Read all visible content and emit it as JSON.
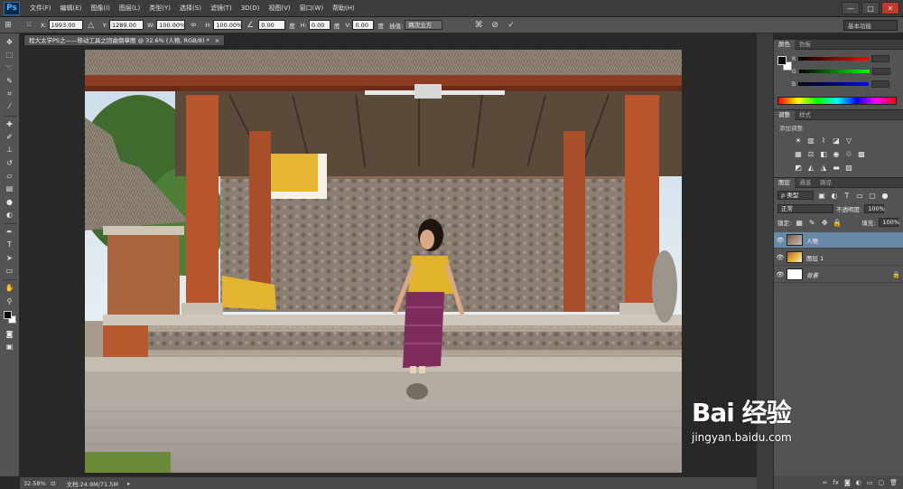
{
  "app": {
    "logo": "Ps"
  },
  "menu": [
    "文件(F)",
    "编辑(E)",
    "图像(I)",
    "图层(L)",
    "类型(Y)",
    "选择(S)",
    "滤镜(T)",
    "3D(D)",
    "视图(V)",
    "窗口(W)",
    "帮助(H)"
  ],
  "window_controls": {
    "minimize": "—",
    "restore": "□",
    "close": "✕"
  },
  "options": {
    "x_label": "X:",
    "x_value": "1993.00 像",
    "y_label": "Y:",
    "y_value": "1289.00 像",
    "w_label": "W:",
    "w_value": "100.00%",
    "h_label": "H:",
    "h_value": "100.00%",
    "angle_value": "0.00",
    "angle_unit": "度",
    "hskew_label": "H:",
    "hskew_value": "0.00",
    "hskew_unit": "度",
    "vskew_label": "V:",
    "vskew_value": "0.00",
    "vskew_unit": "度",
    "interp_label": "插值:",
    "interp_value": "两次立方",
    "workspace": "基本功能"
  },
  "document": {
    "tab_title": "程大太学PS之——移动工具之回曲倒章图 @ 32.6% (人物, RGB/8) *",
    "close": "×"
  },
  "tools": [
    "move-icon",
    "marquee-icon",
    "lasso-icon",
    "quick-select-icon",
    "crop-icon",
    "eyedropper-icon",
    "healing-icon",
    "brush-icon",
    "clone-stamp-icon",
    "history-brush-icon",
    "eraser-icon",
    "gradient-icon",
    "blur-icon",
    "dodge-icon",
    "pen-icon",
    "type-icon",
    "path-select-icon",
    "shape-icon",
    "hand-icon",
    "zoom-icon"
  ],
  "status": {
    "zoom": "32.58%",
    "doc_size": "文档:24.9M/71.5M"
  },
  "color_panel": {
    "tabs": [
      "颜色",
      "色板"
    ],
    "r_label": "R",
    "g_label": "G",
    "b_label": "B"
  },
  "adjustments_panel": {
    "tabs": [
      "调整",
      "样式"
    ],
    "title": "添加调整"
  },
  "layers_panel": {
    "tabs": [
      "图层",
      "通道",
      "路径"
    ],
    "kind_filter": "ρ 类型",
    "blend_mode": "正常",
    "opacity_label": "不透明度:",
    "opacity_value": "100%",
    "lock_label": "锁定:",
    "fill_label": "填充:",
    "fill_value": "100%",
    "layers": [
      {
        "name": "人物",
        "selected": true
      },
      {
        "name": "图层 1",
        "selected": false
      },
      {
        "name": "背景",
        "selected": false,
        "locked": true
      }
    ]
  },
  "watermark": {
    "logo": "Bai 经验",
    "url": "jingyan.baidu.com"
  }
}
